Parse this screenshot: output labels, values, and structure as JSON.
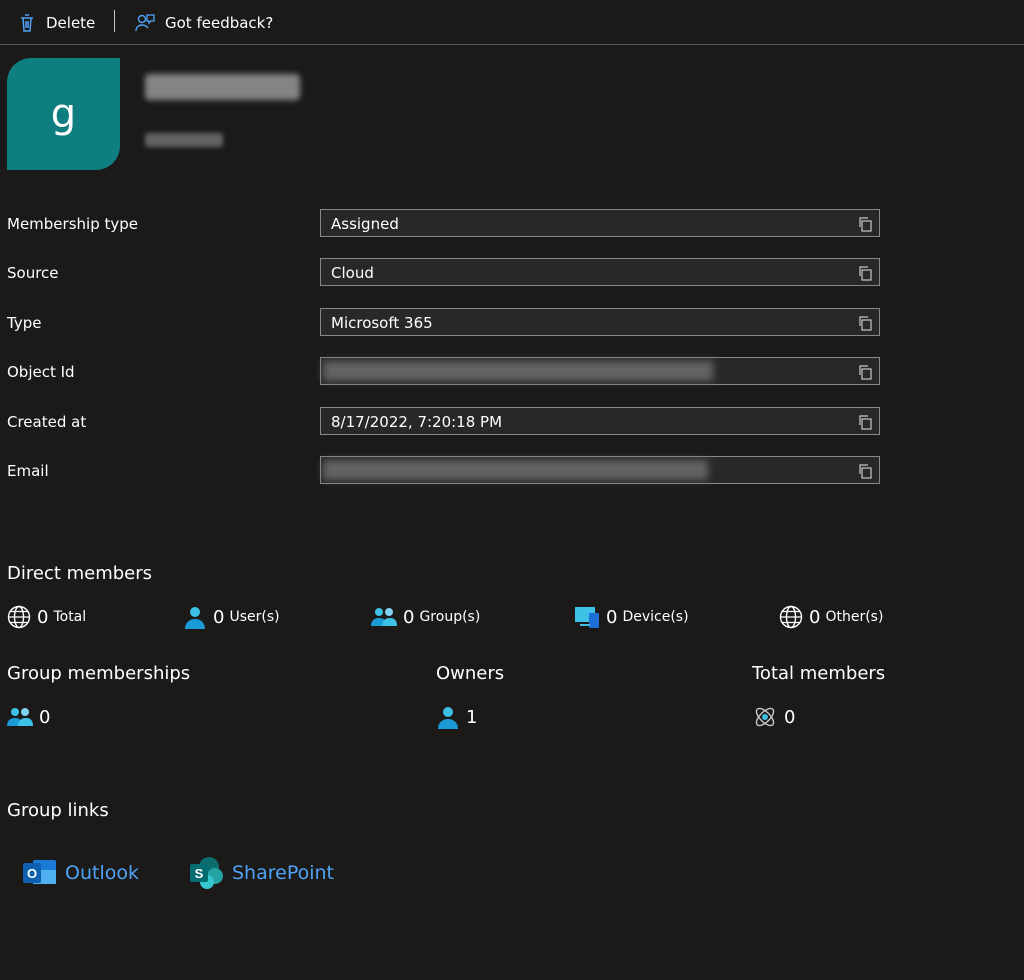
{
  "toolbar": {
    "delete_label": "Delete",
    "feedback_label": "Got feedback?"
  },
  "group": {
    "avatar_letter": "g"
  },
  "properties": [
    {
      "label": "Membership type",
      "value": "Assigned"
    },
    {
      "label": "Source",
      "value": "Cloud"
    },
    {
      "label": "Type",
      "value": "Microsoft 365"
    },
    {
      "label": "Object Id",
      "value": ""
    },
    {
      "label": "Created at",
      "value": "8/17/2022, 7:20:18 PM"
    },
    {
      "label": "Email",
      "value": ""
    }
  ],
  "direct_members": {
    "title": "Direct members",
    "total": {
      "count": "0",
      "label": "Total"
    },
    "users": {
      "count": "0",
      "label": "User(s)"
    },
    "groups": {
      "count": "0",
      "label": "Group(s)"
    },
    "devices": {
      "count": "0",
      "label": "Device(s)"
    },
    "others": {
      "count": "0",
      "label": "Other(s)"
    }
  },
  "group_memberships": {
    "title": "Group memberships",
    "count": "0"
  },
  "owners": {
    "title": "Owners",
    "count": "1"
  },
  "total_members": {
    "title": "Total members",
    "count": "0"
  },
  "group_links": {
    "title": "Group links",
    "outlook": "Outlook",
    "sharepoint": "SharePoint"
  },
  "colors": {
    "accent_teal": "#0f7e81",
    "link_blue": "#4fa3f7",
    "background": "#1b1a19"
  }
}
